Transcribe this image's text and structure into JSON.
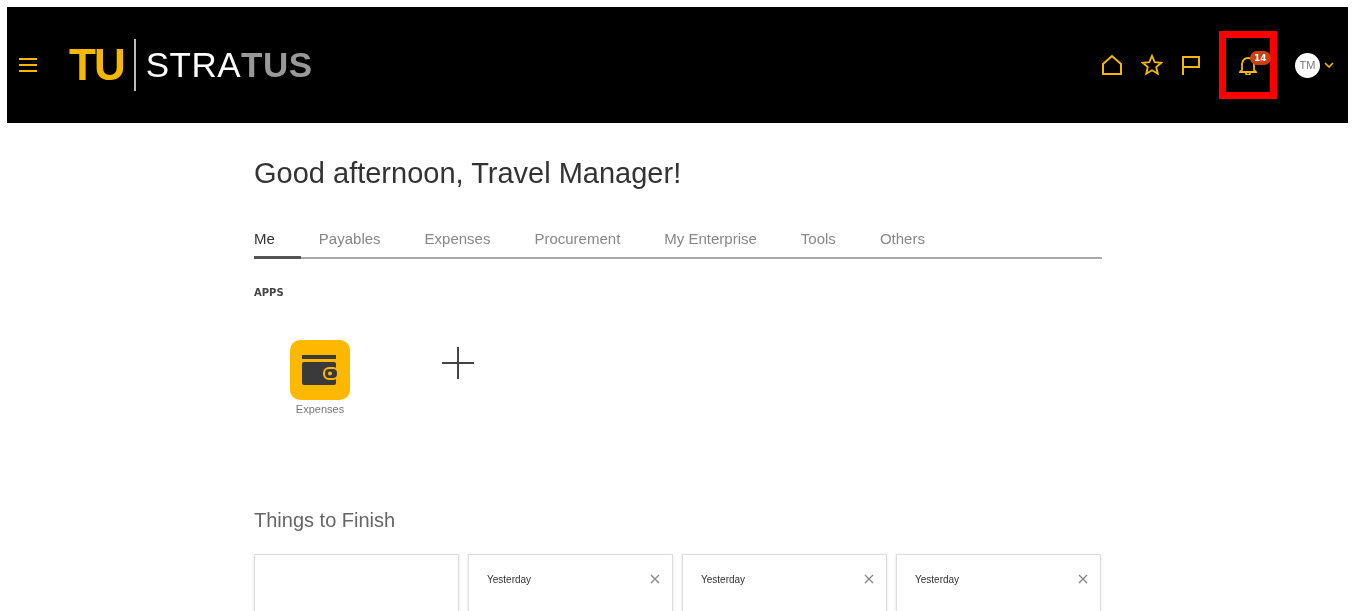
{
  "header": {
    "logo": {
      "mark": "TU",
      "word_light": "STRA",
      "word_grey": "TUS"
    },
    "notifications": {
      "count": "14",
      "highlighted": true
    },
    "avatar": {
      "initials": "TM"
    }
  },
  "greeting": "Good afternoon, Travel Manager!",
  "tabs": [
    {
      "label": "Me",
      "selected": true
    },
    {
      "label": "Payables",
      "selected": false
    },
    {
      "label": "Expenses",
      "selected": false
    },
    {
      "label": "Procurement",
      "selected": false
    },
    {
      "label": "My Enterprise",
      "selected": false
    },
    {
      "label": "Tools",
      "selected": false
    },
    {
      "label": "Others",
      "selected": false
    }
  ],
  "apps": {
    "heading": "APPS",
    "items": [
      {
        "label": "Expenses"
      }
    ]
  },
  "things_to_finish": {
    "heading": "Things to Finish",
    "cards": [
      {
        "kind": "empty"
      },
      {
        "kind": "item",
        "when": "Yesterday"
      },
      {
        "kind": "item",
        "when": "Yesterday"
      },
      {
        "kind": "item",
        "when": "Yesterday"
      }
    ]
  }
}
